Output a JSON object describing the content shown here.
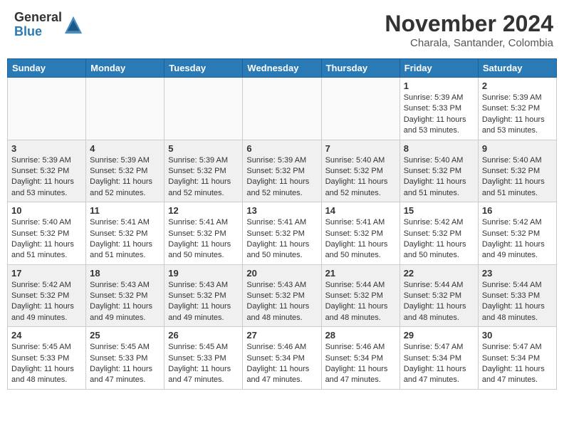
{
  "header": {
    "logo_general": "General",
    "logo_blue": "Blue",
    "month_year": "November 2024",
    "location": "Charala, Santander, Colombia"
  },
  "weekdays": [
    "Sunday",
    "Monday",
    "Tuesday",
    "Wednesday",
    "Thursday",
    "Friday",
    "Saturday"
  ],
  "weeks": [
    [
      {
        "day": "",
        "sunrise": "",
        "sunset": "",
        "daylight": ""
      },
      {
        "day": "",
        "sunrise": "",
        "sunset": "",
        "daylight": ""
      },
      {
        "day": "",
        "sunrise": "",
        "sunset": "",
        "daylight": ""
      },
      {
        "day": "",
        "sunrise": "",
        "sunset": "",
        "daylight": ""
      },
      {
        "day": "",
        "sunrise": "",
        "sunset": "",
        "daylight": ""
      },
      {
        "day": "1",
        "sunrise": "Sunrise: 5:39 AM",
        "sunset": "Sunset: 5:33 PM",
        "daylight": "Daylight: 11 hours and 53 minutes."
      },
      {
        "day": "2",
        "sunrise": "Sunrise: 5:39 AM",
        "sunset": "Sunset: 5:32 PM",
        "daylight": "Daylight: 11 hours and 53 minutes."
      }
    ],
    [
      {
        "day": "3",
        "sunrise": "Sunrise: 5:39 AM",
        "sunset": "Sunset: 5:32 PM",
        "daylight": "Daylight: 11 hours and 53 minutes."
      },
      {
        "day": "4",
        "sunrise": "Sunrise: 5:39 AM",
        "sunset": "Sunset: 5:32 PM",
        "daylight": "Daylight: 11 hours and 52 minutes."
      },
      {
        "day": "5",
        "sunrise": "Sunrise: 5:39 AM",
        "sunset": "Sunset: 5:32 PM",
        "daylight": "Daylight: 11 hours and 52 minutes."
      },
      {
        "day": "6",
        "sunrise": "Sunrise: 5:39 AM",
        "sunset": "Sunset: 5:32 PM",
        "daylight": "Daylight: 11 hours and 52 minutes."
      },
      {
        "day": "7",
        "sunrise": "Sunrise: 5:40 AM",
        "sunset": "Sunset: 5:32 PM",
        "daylight": "Daylight: 11 hours and 52 minutes."
      },
      {
        "day": "8",
        "sunrise": "Sunrise: 5:40 AM",
        "sunset": "Sunset: 5:32 PM",
        "daylight": "Daylight: 11 hours and 51 minutes."
      },
      {
        "day": "9",
        "sunrise": "Sunrise: 5:40 AM",
        "sunset": "Sunset: 5:32 PM",
        "daylight": "Daylight: 11 hours and 51 minutes."
      }
    ],
    [
      {
        "day": "10",
        "sunrise": "Sunrise: 5:40 AM",
        "sunset": "Sunset: 5:32 PM",
        "daylight": "Daylight: 11 hours and 51 minutes."
      },
      {
        "day": "11",
        "sunrise": "Sunrise: 5:41 AM",
        "sunset": "Sunset: 5:32 PM",
        "daylight": "Daylight: 11 hours and 51 minutes."
      },
      {
        "day": "12",
        "sunrise": "Sunrise: 5:41 AM",
        "sunset": "Sunset: 5:32 PM",
        "daylight": "Daylight: 11 hours and 50 minutes."
      },
      {
        "day": "13",
        "sunrise": "Sunrise: 5:41 AM",
        "sunset": "Sunset: 5:32 PM",
        "daylight": "Daylight: 11 hours and 50 minutes."
      },
      {
        "day": "14",
        "sunrise": "Sunrise: 5:41 AM",
        "sunset": "Sunset: 5:32 PM",
        "daylight": "Daylight: 11 hours and 50 minutes."
      },
      {
        "day": "15",
        "sunrise": "Sunrise: 5:42 AM",
        "sunset": "Sunset: 5:32 PM",
        "daylight": "Daylight: 11 hours and 50 minutes."
      },
      {
        "day": "16",
        "sunrise": "Sunrise: 5:42 AM",
        "sunset": "Sunset: 5:32 PM",
        "daylight": "Daylight: 11 hours and 49 minutes."
      }
    ],
    [
      {
        "day": "17",
        "sunrise": "Sunrise: 5:42 AM",
        "sunset": "Sunset: 5:32 PM",
        "daylight": "Daylight: 11 hours and 49 minutes."
      },
      {
        "day": "18",
        "sunrise": "Sunrise: 5:43 AM",
        "sunset": "Sunset: 5:32 PM",
        "daylight": "Daylight: 11 hours and 49 minutes."
      },
      {
        "day": "19",
        "sunrise": "Sunrise: 5:43 AM",
        "sunset": "Sunset: 5:32 PM",
        "daylight": "Daylight: 11 hours and 49 minutes."
      },
      {
        "day": "20",
        "sunrise": "Sunrise: 5:43 AM",
        "sunset": "Sunset: 5:32 PM",
        "daylight": "Daylight: 11 hours and 48 minutes."
      },
      {
        "day": "21",
        "sunrise": "Sunrise: 5:44 AM",
        "sunset": "Sunset: 5:32 PM",
        "daylight": "Daylight: 11 hours and 48 minutes."
      },
      {
        "day": "22",
        "sunrise": "Sunrise: 5:44 AM",
        "sunset": "Sunset: 5:32 PM",
        "daylight": "Daylight: 11 hours and 48 minutes."
      },
      {
        "day": "23",
        "sunrise": "Sunrise: 5:44 AM",
        "sunset": "Sunset: 5:33 PM",
        "daylight": "Daylight: 11 hours and 48 minutes."
      }
    ],
    [
      {
        "day": "24",
        "sunrise": "Sunrise: 5:45 AM",
        "sunset": "Sunset: 5:33 PM",
        "daylight": "Daylight: 11 hours and 48 minutes."
      },
      {
        "day": "25",
        "sunrise": "Sunrise: 5:45 AM",
        "sunset": "Sunset: 5:33 PM",
        "daylight": "Daylight: 11 hours and 47 minutes."
      },
      {
        "day": "26",
        "sunrise": "Sunrise: 5:45 AM",
        "sunset": "Sunset: 5:33 PM",
        "daylight": "Daylight: 11 hours and 47 minutes."
      },
      {
        "day": "27",
        "sunrise": "Sunrise: 5:46 AM",
        "sunset": "Sunset: 5:34 PM",
        "daylight": "Daylight: 11 hours and 47 minutes."
      },
      {
        "day": "28",
        "sunrise": "Sunrise: 5:46 AM",
        "sunset": "Sunset: 5:34 PM",
        "daylight": "Daylight: 11 hours and 47 minutes."
      },
      {
        "day": "29",
        "sunrise": "Sunrise: 5:47 AM",
        "sunset": "Sunset: 5:34 PM",
        "daylight": "Daylight: 11 hours and 47 minutes."
      },
      {
        "day": "30",
        "sunrise": "Sunrise: 5:47 AM",
        "sunset": "Sunset: 5:34 PM",
        "daylight": "Daylight: 11 hours and 47 minutes."
      }
    ]
  ]
}
